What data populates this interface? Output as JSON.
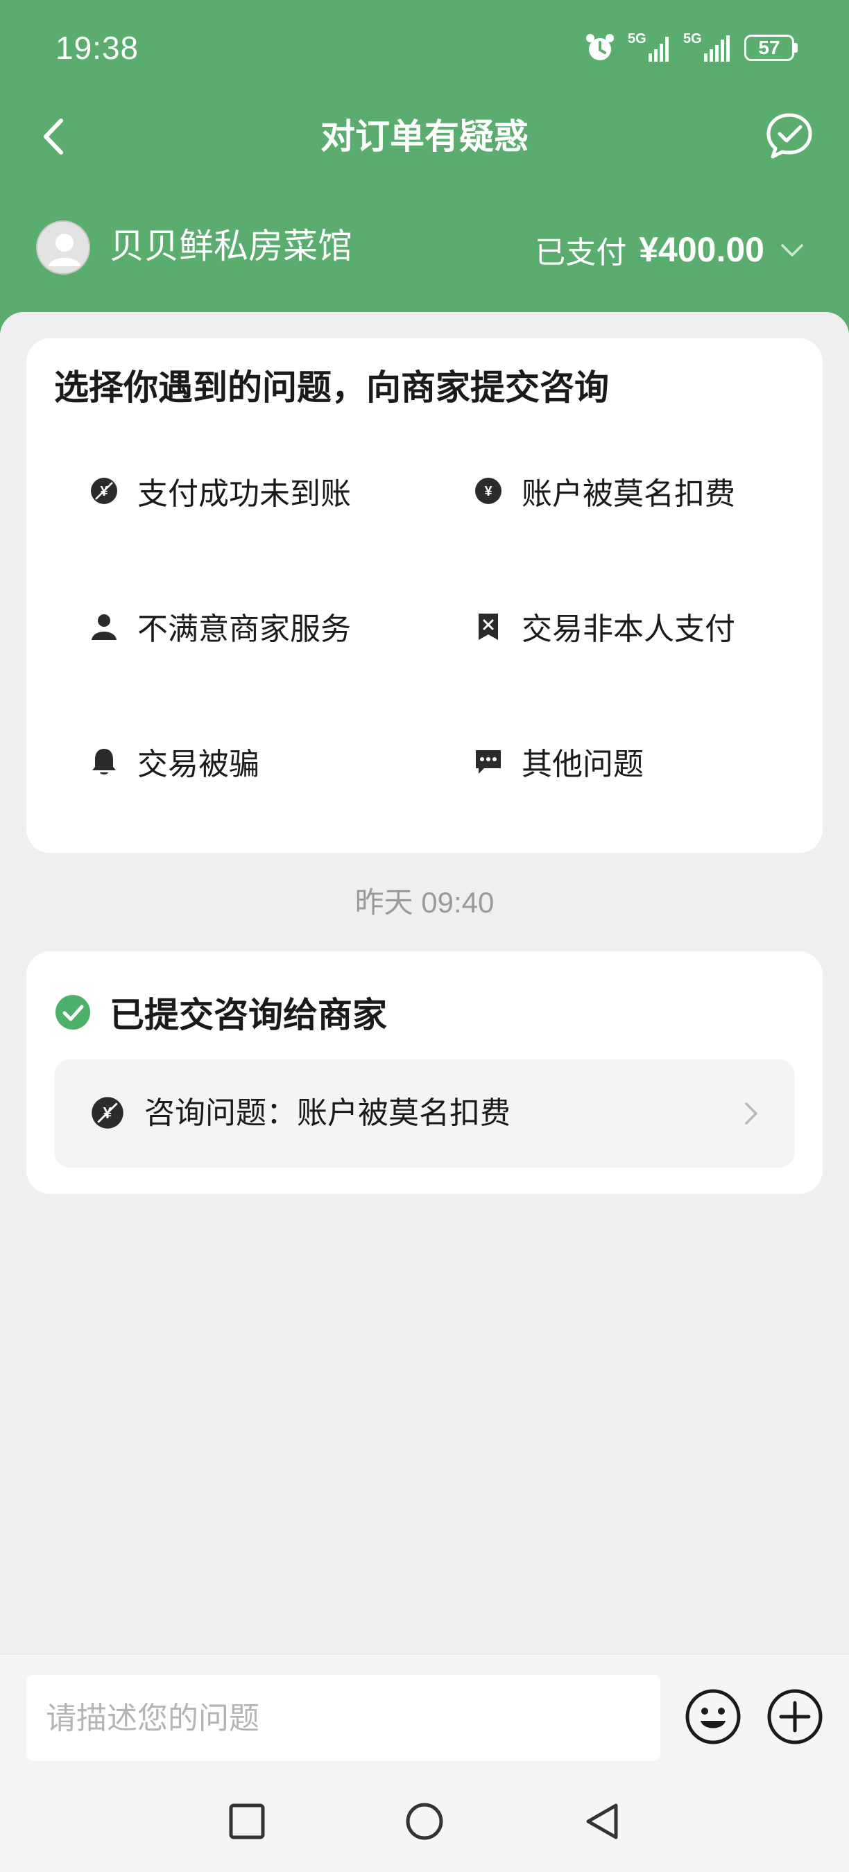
{
  "status": {
    "time": "19:38",
    "battery": "57",
    "network_a": "5G",
    "network_b": "5G"
  },
  "nav": {
    "title": "对订单有疑惑"
  },
  "merchant": {
    "name": "贝贝鲜私房菜馆",
    "paid_label": "已支付",
    "amount": "¥400.00"
  },
  "issues": {
    "heading": "选择你遇到的问题，向商家提交咨询",
    "items": [
      {
        "label": "支付成功未到账",
        "icon": "yen-slash-icon"
      },
      {
        "label": "账户被莫名扣费",
        "icon": "yen-coin-icon"
      },
      {
        "label": "不满意商家服务",
        "icon": "person-icon"
      },
      {
        "label": "交易非本人支付",
        "icon": "bookmark-x-icon"
      },
      {
        "label": "交易被骗",
        "icon": "bell-icon"
      },
      {
        "label": "其他问题",
        "icon": "chat-dots-icon"
      }
    ]
  },
  "timestamp": "昨天 09:40",
  "submitted": {
    "title": "已提交咨询给商家",
    "inquiry_text": "咨询问题：账户被莫名扣费"
  },
  "composer": {
    "placeholder": "请描述您的问题"
  },
  "colors": {
    "header_green": "#5aad6e",
    "check_green": "#4caf6a",
    "background": "#efefef"
  }
}
